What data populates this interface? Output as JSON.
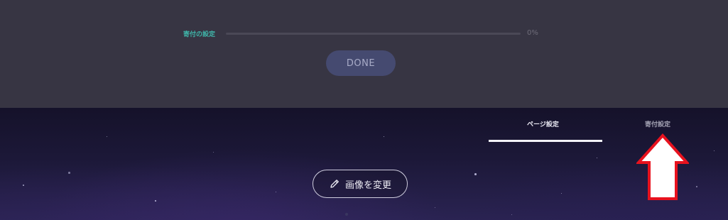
{
  "setup": {
    "progress_label": "寄付の設定",
    "progress_percent_text": "0%",
    "progress_value": 0,
    "done_label": "DONE"
  },
  "header": {
    "tabs": [
      {
        "label": "ページ設定",
        "active": true
      },
      {
        "label": "寄付設定",
        "active": false
      }
    ],
    "change_image_label": "画像を変更",
    "change_image_icon": "pencil-icon",
    "annotation_icon": "up-arrow-icon"
  },
  "colors": {
    "accent": "#3fb6aa",
    "panel_bg": "#373543",
    "done_bg": "#454a70",
    "annotation_red": "#e8121e"
  }
}
